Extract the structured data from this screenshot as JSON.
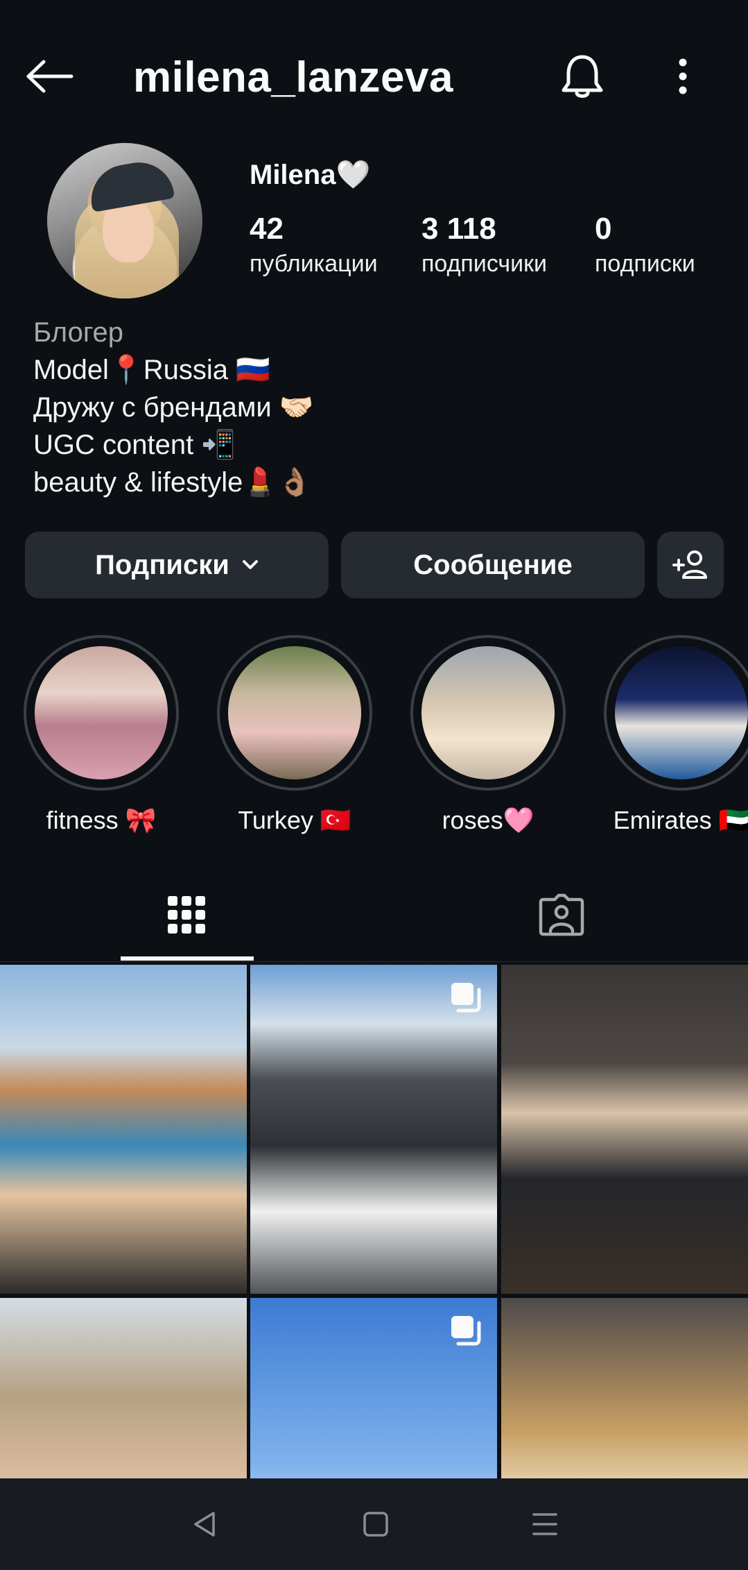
{
  "header": {
    "username": "milena_lanzeva",
    "back_icon": "arrow-left-icon",
    "bell_icon": "bell-icon",
    "more_icon": "more-vertical-icon"
  },
  "profile": {
    "display_name": "Milena🤍",
    "stats": {
      "posts": {
        "value": "42",
        "label": "публикации"
      },
      "followers": {
        "value": "3 118",
        "label": "подписчики"
      },
      "following": {
        "value": "0",
        "label": "подписки"
      }
    },
    "bio": {
      "category": "Блогер",
      "lines": [
        "Model📍Russia 🇷🇺",
        "Дружу с брендами 🤝🏻",
        "UGC content 📲",
        "beauty & lifestyle💄👌🏽"
      ]
    }
  },
  "actions": {
    "following_label": "Подписки",
    "message_label": "Сообщение",
    "add_user_icon": "person-add-icon"
  },
  "highlights": [
    {
      "label": "fitness 🎀"
    },
    {
      "label": "Turkey 🇹🇷"
    },
    {
      "label": "roses🩷"
    },
    {
      "label": "Emirates 🇦🇪"
    }
  ],
  "tabs": {
    "grid_icon": "grid-icon",
    "tagged_icon": "tagged-person-icon"
  },
  "posts": [
    {
      "multi": false
    },
    {
      "multi": true
    },
    {
      "multi": false
    },
    {
      "multi": false
    },
    {
      "multi": true
    },
    {
      "multi": false
    }
  ],
  "colors": {
    "background": "#0c1014",
    "button": "#262b31",
    "text": "#f5f5f5",
    "muted": "#a8a8a8"
  }
}
